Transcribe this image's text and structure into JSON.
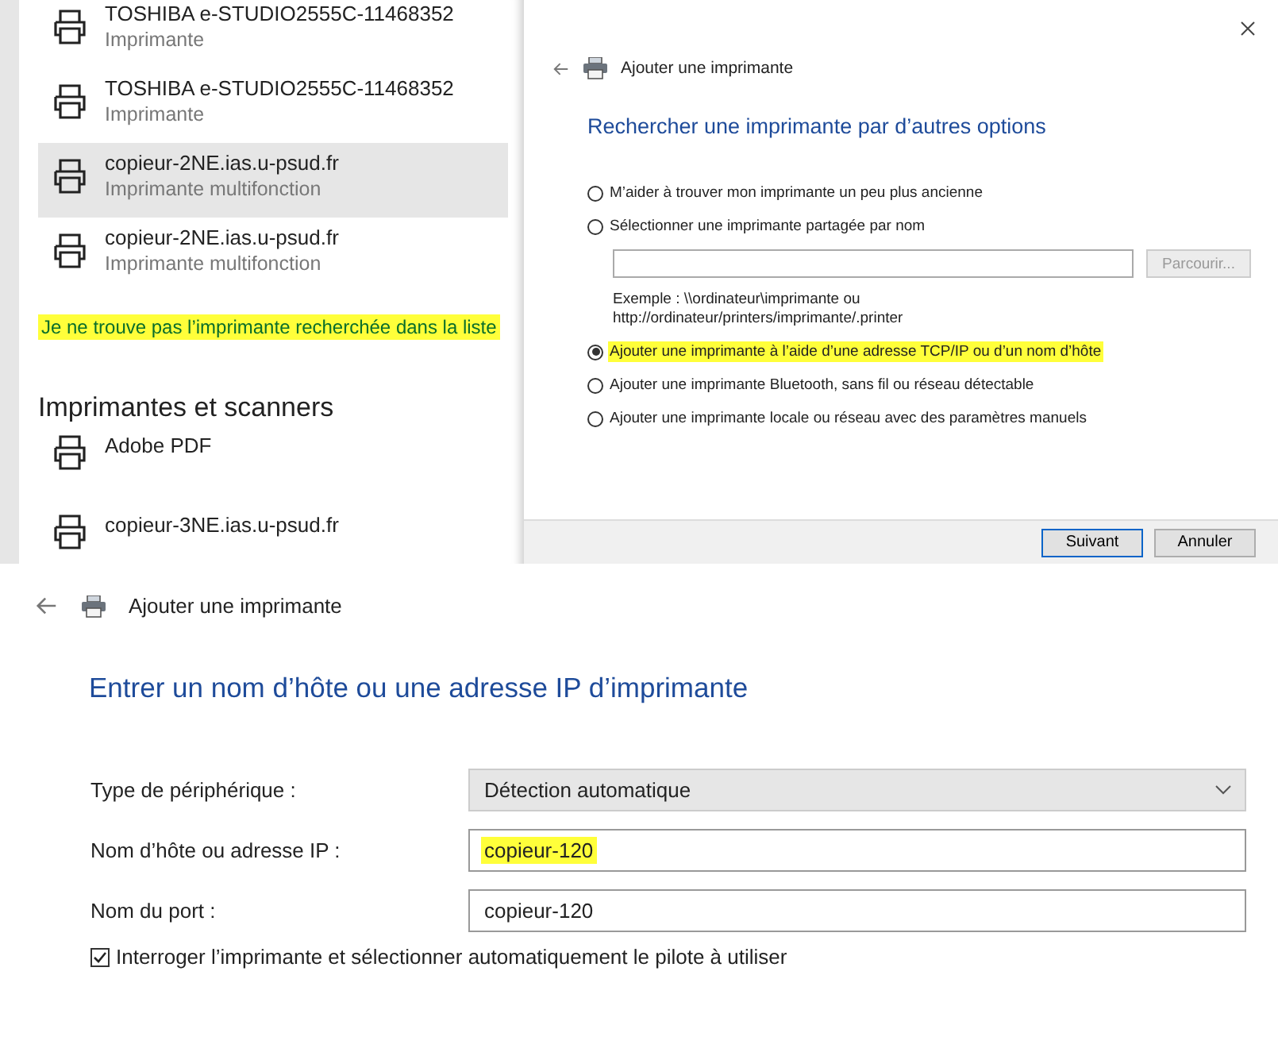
{
  "printer_list": {
    "items": [
      {
        "name": "TOSHIBA e-STUDIO2555C-11468352",
        "type": "Imprimante",
        "selected": false
      },
      {
        "name": "TOSHIBA e-STUDIO2555C-11468352",
        "type": "Imprimante",
        "selected": false
      },
      {
        "name": "copieur-2NE.ias.u-psud.fr",
        "type": "Imprimante multifonction",
        "selected": true
      },
      {
        "name": "copieur-2NE.ias.u-psud.fr",
        "type": "Imprimante multifonction",
        "selected": false
      }
    ]
  },
  "missing_link": {
    "text": "Je ne trouve pas l’imprimante recherchée dans la liste",
    "highlighted": true
  },
  "section_heading": "Imprimantes et scanners",
  "installed_printers": [
    {
      "name": "Adobe PDF"
    },
    {
      "name": "copieur-3NE.ias.u-psud.fr"
    }
  ],
  "dialog_options": {
    "title": "Ajouter une imprimante",
    "heading": "Rechercher une imprimante par d’autres options",
    "options": [
      {
        "label": "M’aider à trouver mon imprimante un peu plus ancienne",
        "selected": false,
        "highlighted": false,
        "kind": "plain"
      },
      {
        "label": "Sélectionner une imprimante partagée par nom",
        "selected": false,
        "highlighted": false,
        "kind": "share"
      },
      {
        "label": "Ajouter une imprimante à l’aide d’une adresse TCP/IP ou d’un nom d’hôte",
        "selected": true,
        "highlighted": true,
        "kind": "plain"
      },
      {
        "label": "Ajouter une imprimante Bluetooth, sans fil ou réseau détectable",
        "selected": false,
        "highlighted": false,
        "kind": "plain"
      },
      {
        "label": "Ajouter une imprimante locale ou réseau avec des paramètres manuels",
        "selected": false,
        "highlighted": false,
        "kind": "plain"
      }
    ],
    "browse_button": {
      "label": "Parcourir...",
      "disabled": true
    },
    "example": "Exemple : \\\\ordinateur\\imprimante ou\nhttp://ordinateur/printers/imprimante/.printer",
    "buttons": [
      {
        "label": "Suivant",
        "default": true
      },
      {
        "label": "Annuler",
        "default": false
      }
    ]
  },
  "dialog_hostname": {
    "title": "Ajouter une imprimante",
    "heading": "Entrer un nom d’hôte ou une adresse IP d’imprimante",
    "fields": [
      {
        "label": "Type de périphérique :",
        "value": "Détection automatique",
        "kind": "dropdown",
        "highlighted": false
      },
      {
        "label": "Nom d’hôte ou adresse IP :",
        "value": "copieur-120",
        "kind": "text",
        "highlighted": true
      },
      {
        "label": "Nom du port :",
        "value": "copieur-120",
        "kind": "text",
        "highlighted": false
      }
    ],
    "checkbox": {
      "label": "Interroger l’imprimante et sélectionner automatiquement le pilote à utiliser",
      "checked": true
    }
  }
}
